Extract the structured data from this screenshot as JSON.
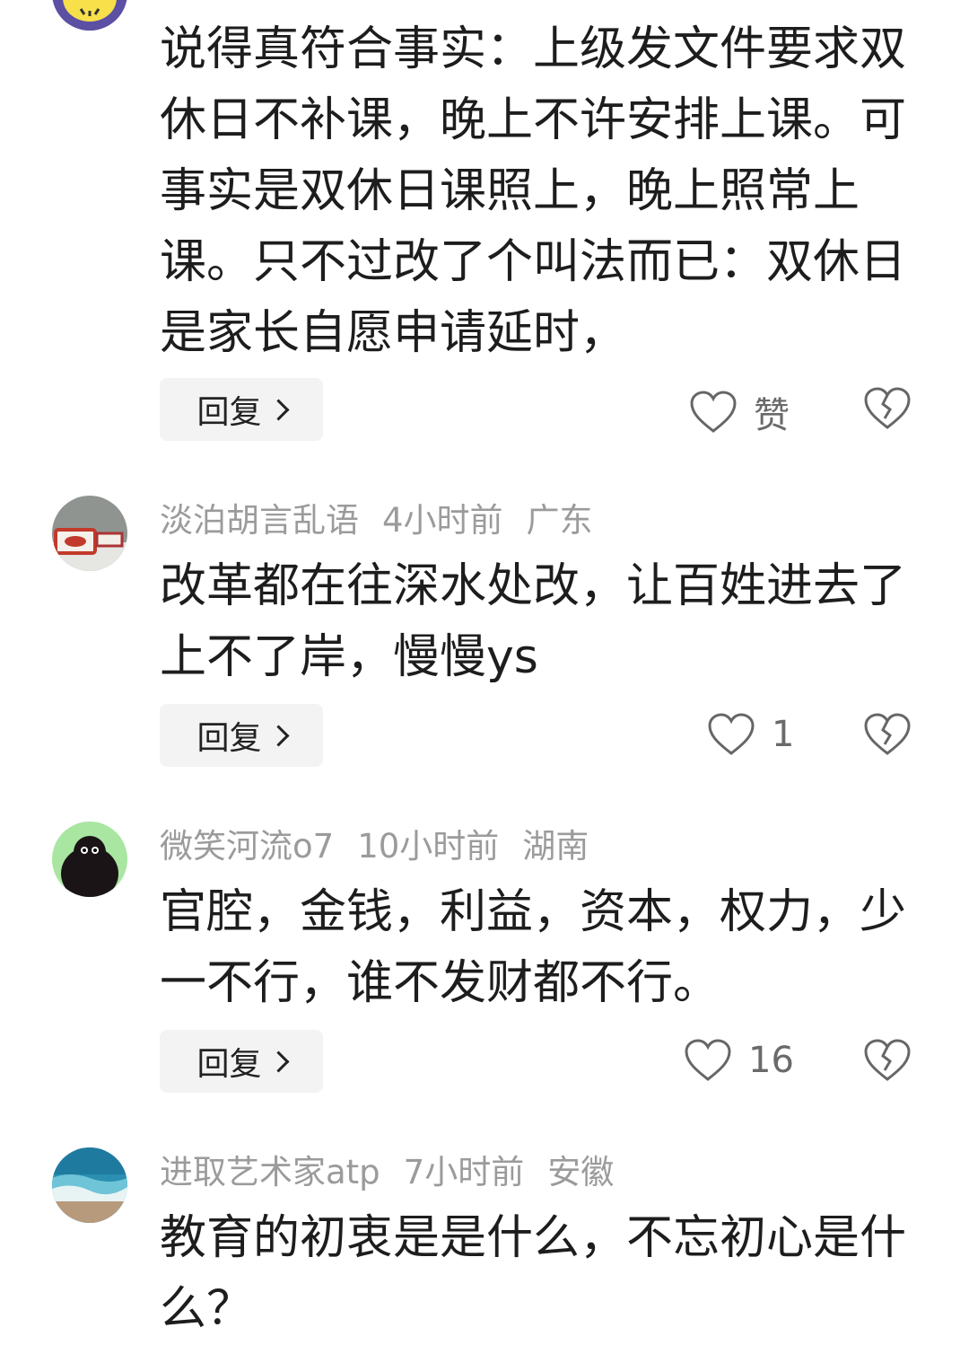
{
  "comments": [
    {
      "username": "",
      "time": "",
      "location": "",
      "text": "说得真符合事实：上级发文件要求双休日不补课，晚上不许安排上课。可事实是双休日课照上，晚上照常上课。只不过改了个叫法而已：双休日是家长自愿申请延时，",
      "reply_label": "回复",
      "like_label": "赞",
      "avatar_icon": "yellow-emoji-avatar-icon"
    },
    {
      "username": "淡泊胡言乱语",
      "time": "4小时前",
      "location": "广东",
      "text": "改革都在往深水处改，让百姓进去了上不了岸，慢慢ys",
      "reply_label": "回复",
      "like_label": "1",
      "avatar_icon": "porcelain-photo-avatar-icon"
    },
    {
      "username": "微笑河流o7",
      "time": "10小时前",
      "location": "湖南",
      "text": "官腔，金钱，利益，资本，权力，少一不行，谁不发财都不行。",
      "reply_label": "回复",
      "like_label": "16",
      "avatar_icon": "black-bird-avatar-icon"
    },
    {
      "username": "进取艺术家atp",
      "time": "7小时前",
      "location": "安徽",
      "text": "教育的初衷是是什么，不忘初心是什么？",
      "reply_label": "",
      "like_label": "",
      "avatar_icon": "ocean-wave-avatar-icon"
    }
  ],
  "colors": {
    "meta_text": "#9b9b9b",
    "body_text": "#1d1d1d",
    "reply_bg": "#f3f3f3",
    "icon_stroke": "#666666"
  }
}
